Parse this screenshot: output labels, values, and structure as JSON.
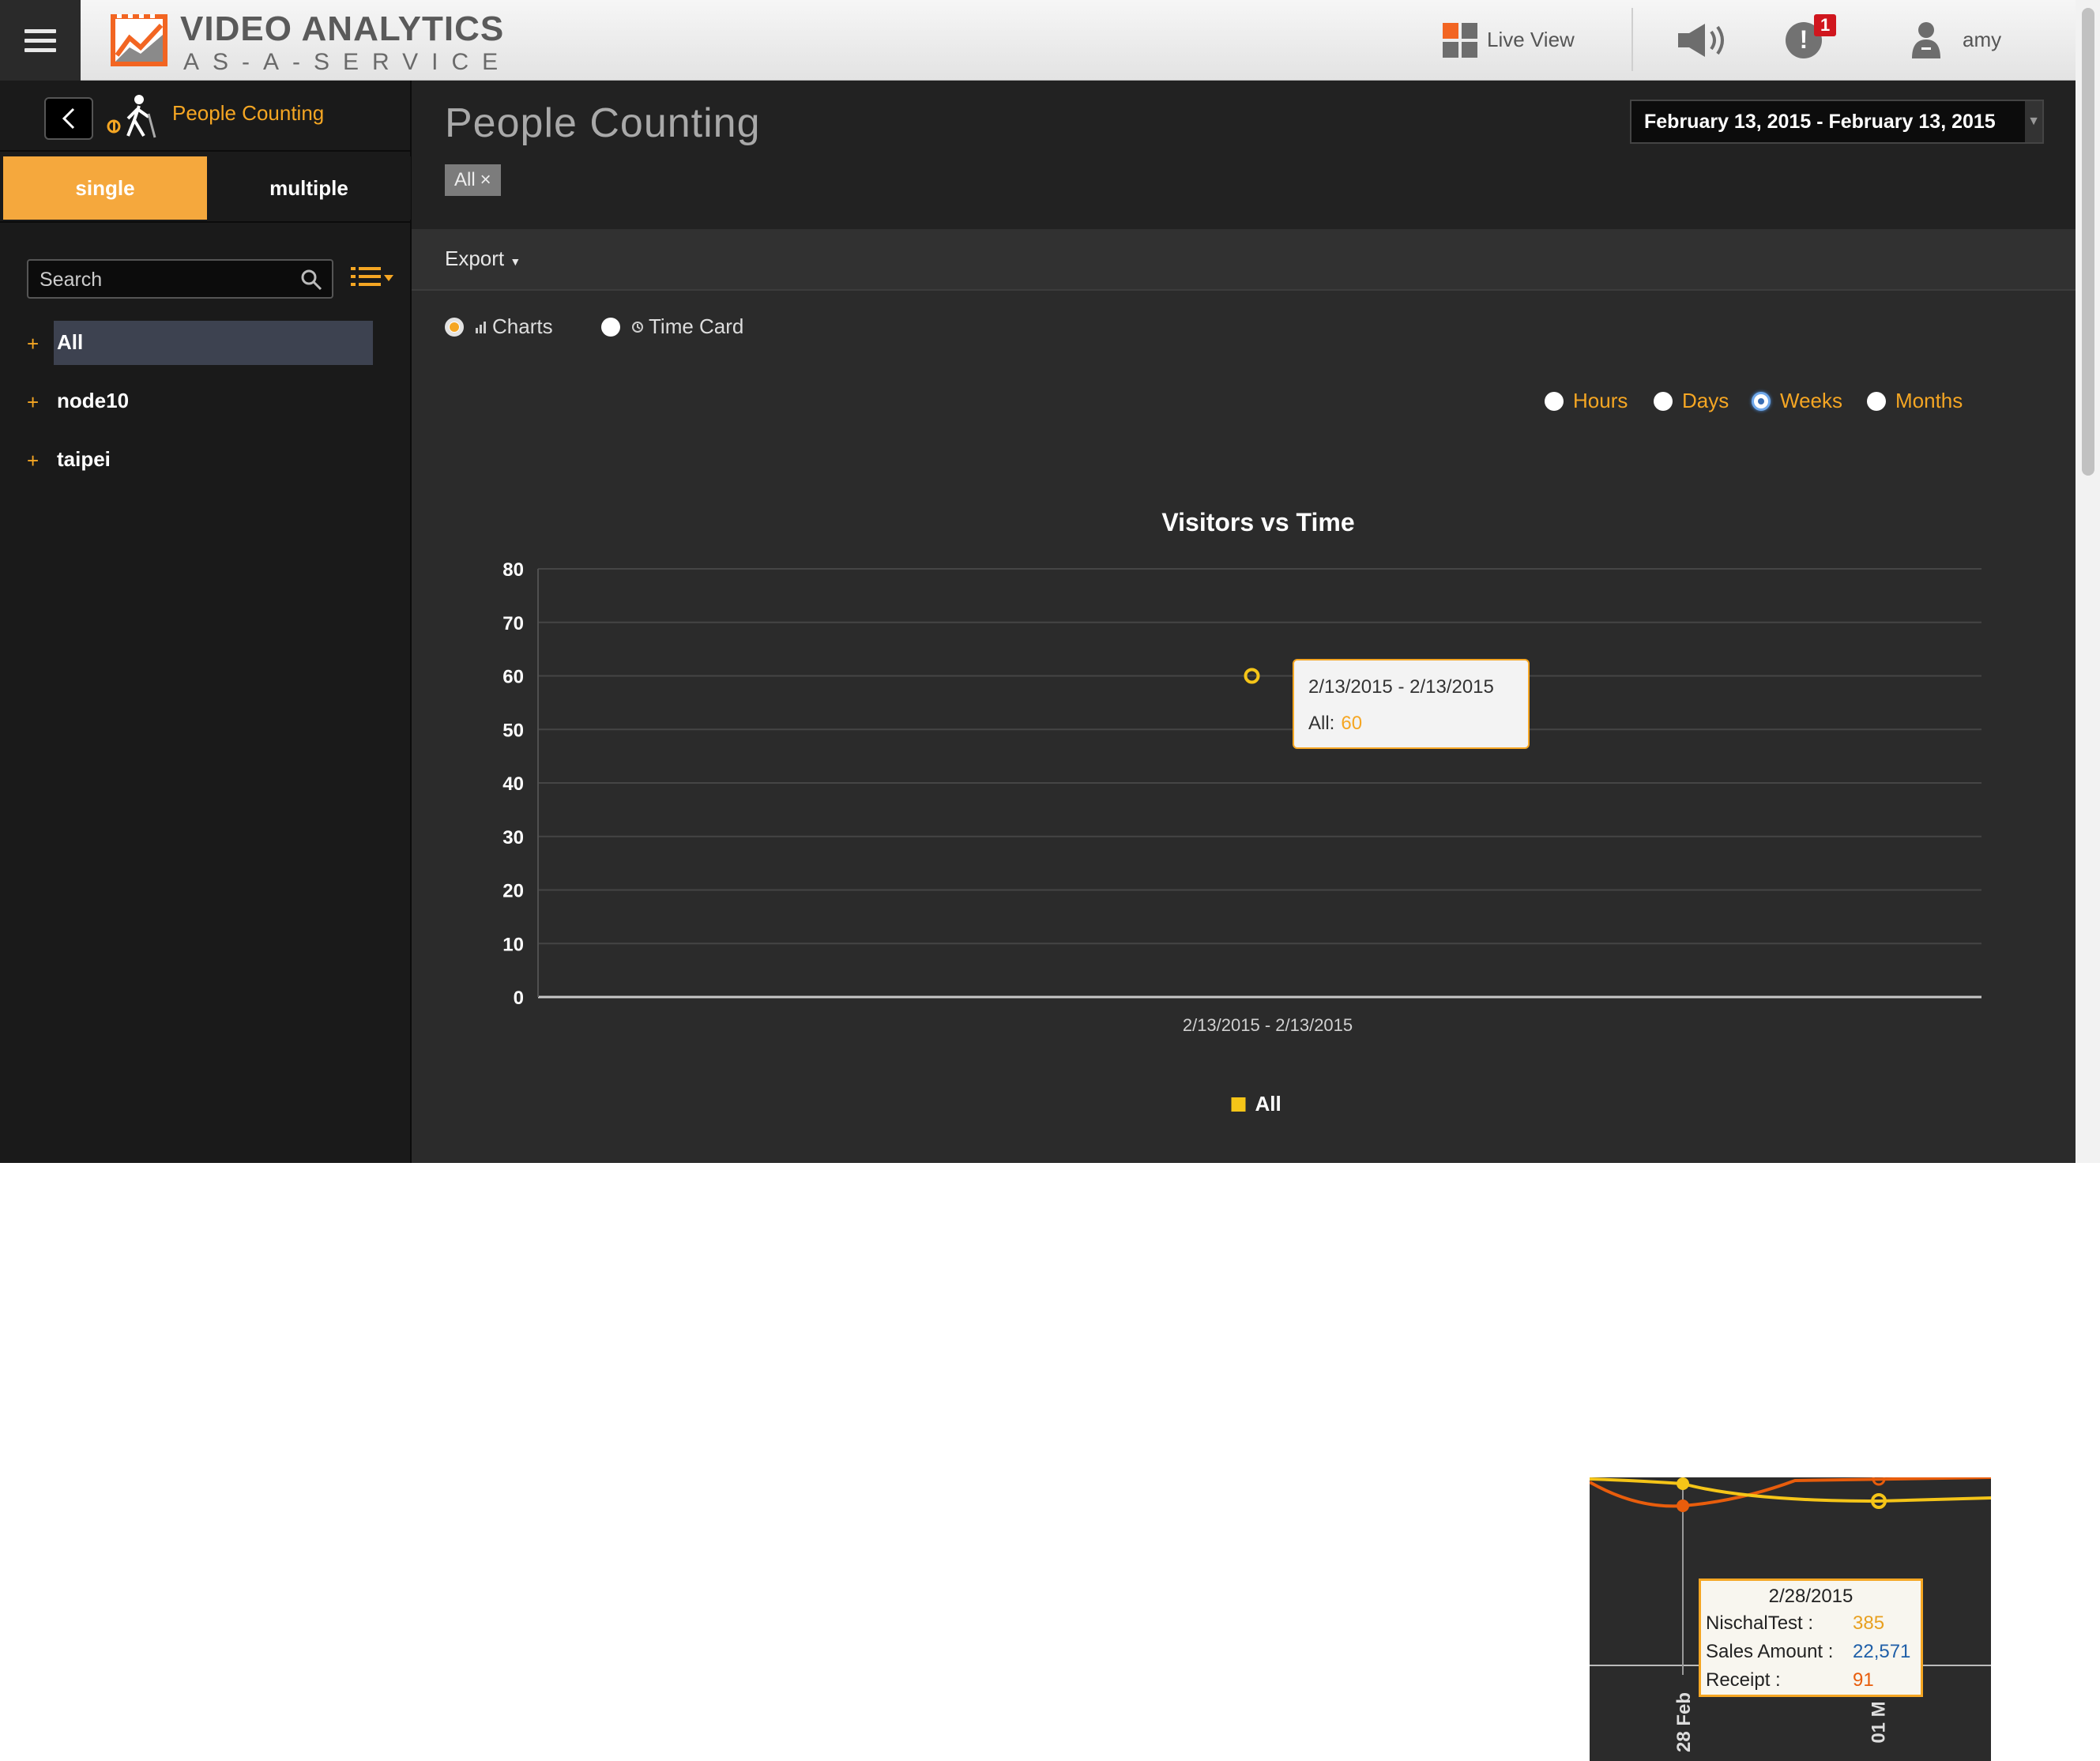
{
  "topbar": {
    "logo_line1": "VIDEO ANALYTICS",
    "logo_line2": "AS-A-SERVICE",
    "live_view": "Live View",
    "alert_count": "1",
    "alert_glyph": "!",
    "user": "amy",
    "icons": [
      "menu-icon",
      "logo-icon",
      "live-view-grid-icon",
      "speaker-icon",
      "alert-icon",
      "user-icon"
    ]
  },
  "sidebar": {
    "title": "People Counting",
    "tabs": [
      "single",
      "multiple"
    ],
    "active_tab": "single",
    "search_placeholder": "Search",
    "tree": [
      {
        "label": "All",
        "active": true
      },
      {
        "label": "node10",
        "active": false
      },
      {
        "label": "taipei",
        "active": false
      }
    ]
  },
  "main": {
    "title": "People Counting",
    "filter_chip": "All",
    "filter_chip_close": "×",
    "date_range": "February 13, 2015 - February 13, 2015",
    "export_label": "Export",
    "view_options": [
      "Charts",
      "Time Card"
    ],
    "selected_view": "Charts",
    "granularity": [
      "Hours",
      "Days",
      "Weeks",
      "Months"
    ],
    "selected_granularity": "Weeks",
    "tooltip": {
      "title": "2/13/2015 - 2/13/2015",
      "series": "All:",
      "value": "60"
    }
  },
  "colors": {
    "accent": "#f5a623",
    "series_all": "#f5c518",
    "background": "#2b2b2b",
    "alert": "#d0161e"
  },
  "chart_data": {
    "type": "line",
    "title": "Visitors vs Time",
    "categories": [
      "2/13/2015 - 2/13/2015"
    ],
    "series": [
      {
        "name": "All",
        "values": [
          60
        ],
        "color": "#f5c518"
      }
    ],
    "ylim": [
      0,
      80
    ],
    "yticks": [
      0,
      10,
      20,
      30,
      40,
      50,
      60,
      70,
      80
    ],
    "grid": true,
    "legend": "bottom"
  },
  "inset": {
    "tooltip": {
      "date": "2/28/2015",
      "rows": [
        {
          "label": "NischalTest :",
          "value": "385",
          "color": "#e8a020"
        },
        {
          "label": "Sales Amount :",
          "value": "22,571",
          "color": "#1f5fa8"
        },
        {
          "label": "Receipt :",
          "value": "91",
          "color": "#e85d0c"
        }
      ]
    },
    "x_labels": [
      "28 Feb",
      "01 M"
    ]
  }
}
